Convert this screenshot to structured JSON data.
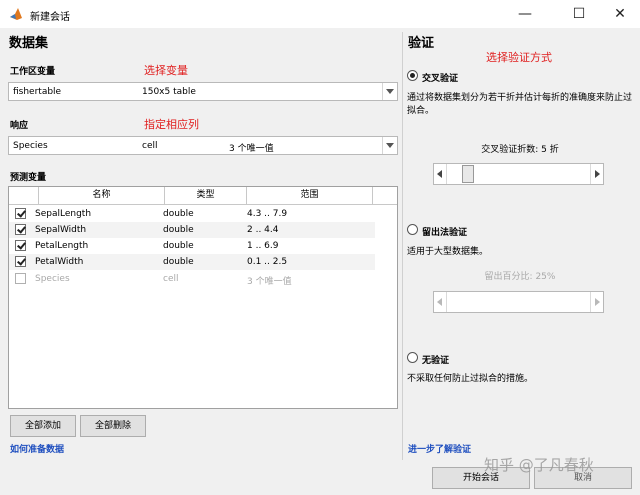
{
  "window": {
    "title": "新建会话",
    "minimize": "—",
    "maximize": "☐",
    "close": "✕"
  },
  "dataset": {
    "title": "数据集",
    "workspace_label": "工作区变量",
    "workspace_note": "选择变量",
    "workspace_value": "fishertable",
    "workspace_info": "150x5 table",
    "response_label": "响应",
    "response_note": "指定相应列",
    "response_value": "Species",
    "response_type": "cell",
    "response_range": "3 个唯一值",
    "predictors_label": "预测变量",
    "columns": [
      "名称",
      "类型",
      "范围"
    ],
    "rows": [
      {
        "name": "SepalLength",
        "type": "double",
        "range": "4.3 .. 7.9",
        "checked": true
      },
      {
        "name": "SepalWidth",
        "type": "double",
        "range": "2 .. 4.4",
        "checked": true
      },
      {
        "name": "PetalLength",
        "type": "double",
        "range": "1 .. 6.9",
        "checked": true
      },
      {
        "name": "PetalWidth",
        "type": "double",
        "range": "0.1 .. 2.5",
        "checked": true
      },
      {
        "name": "Species",
        "type": "cell",
        "range": "3 个唯一值",
        "checked": false
      }
    ],
    "add_all": "全部添加",
    "remove_all": "全部删除",
    "how_to_link": "如何准备数据"
  },
  "validation": {
    "title": "验证",
    "note": "选择验证方式",
    "cross_label": "交叉验证",
    "cross_desc": "通过将数据集划分为若干折并估计每折的准确度来防止过拟合。",
    "folds_label": "交叉验证折数: 5 折",
    "folds_value": 5,
    "folds_min": 2,
    "folds_max": 50,
    "holdout_label": "留出法验证",
    "holdout_desc": "适用于大型数据集。",
    "holdout_pct_label": "留出百分比: 25%",
    "holdout_pct": 25,
    "none_label": "无验证",
    "none_desc": "不采取任何防止过拟合的措施。",
    "learn_more": "进一步了解验证"
  },
  "footer": {
    "start": "开始会话",
    "cancel": "取消",
    "watermark": "知乎 @了凡春秋"
  },
  "colors": {
    "accent_red": "#e02020",
    "link_blue": "#1f4fbf"
  }
}
